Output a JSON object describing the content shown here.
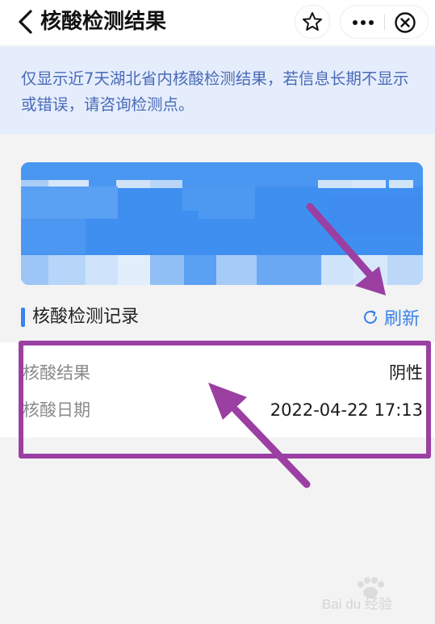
{
  "header": {
    "title": "核酸检测结果",
    "icons": [
      "back-icon",
      "star-icon",
      "more-icon",
      "close-icon"
    ]
  },
  "notice": {
    "text": "仅显示近7天湖北省内核酸检测结果，若信息长期不显示或错误，请咨询检测点。"
  },
  "records": {
    "section_title": "核酸检测记录",
    "refresh_label": "刷新",
    "rows": [
      {
        "label": "核酸结果",
        "value": "阴性"
      },
      {
        "label": "核酸日期",
        "value": "2022-04-22 17:13"
      }
    ]
  },
  "annotation": {
    "color": "#9b3fa3"
  },
  "watermark": {
    "text": "Bai du 经验",
    "logo": "paw-icon"
  },
  "colors": {
    "accent": "#3a80e6",
    "notice_bg": "#e5edfc",
    "notice_text": "#4a6bb8"
  }
}
